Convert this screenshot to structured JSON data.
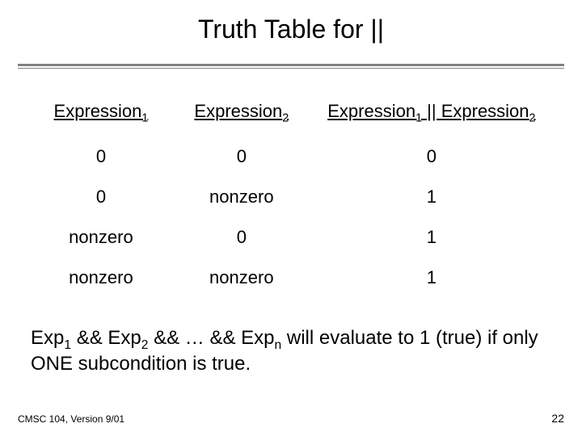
{
  "title": "Truth Table for ||",
  "headers": {
    "col1_base": "Expression",
    "col1_sub": "1",
    "col2_base": "Expression",
    "col2_sub": "2",
    "col3_a_base": "Expression",
    "col3_a_sub": "1",
    "col3_op": " || ",
    "col3_b_base": "Expression",
    "col3_b_sub": "2"
  },
  "rows": [
    {
      "c1": "0",
      "c2": "0",
      "c3": "0"
    },
    {
      "c1": "0",
      "c2": "nonzero",
      "c3": "1"
    },
    {
      "c1": "nonzero",
      "c2": "0",
      "c3": "1"
    },
    {
      "c1": "nonzero",
      "c2": "nonzero",
      "c3": "1"
    }
  ],
  "note": {
    "p1": "Exp",
    "s1": "1",
    "p2": " && Exp",
    "s2": "2",
    "p3": " && … && Exp",
    "s3": "n",
    "p4": "  will evaluate to 1 (true) if only ONE subcondition is true."
  },
  "footer": {
    "left": "CMSC 104, Version 9/01",
    "right": "22"
  },
  "chart_data": {
    "type": "table",
    "title": "Truth Table for ||",
    "columns": [
      "Expression1",
      "Expression2",
      "Expression1 || Expression2"
    ],
    "rows": [
      [
        "0",
        "0",
        "0"
      ],
      [
        "0",
        "nonzero",
        "1"
      ],
      [
        "nonzero",
        "0",
        "1"
      ],
      [
        "nonzero",
        "nonzero",
        "1"
      ]
    ]
  }
}
